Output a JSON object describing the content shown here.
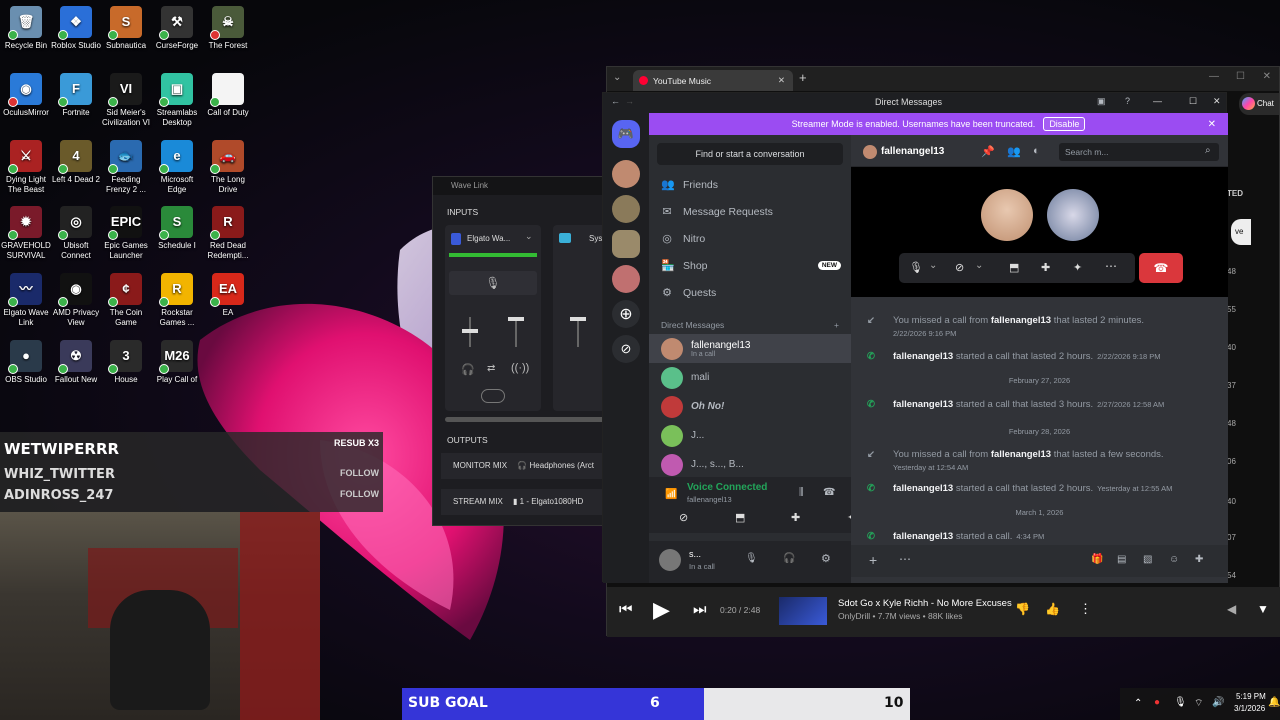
{
  "desktop_icons": [
    {
      "label": "Recycle Bin",
      "color": "#6a8fb0",
      "glyph": "🗑"
    },
    {
      "label": "Roblox Studio",
      "color": "#2a6fd8",
      "glyph": "❖"
    },
    {
      "label": "Subnautica",
      "color": "#c86a2a",
      "glyph": "S"
    },
    {
      "label": "CurseForge",
      "color": "#333",
      "glyph": "⚒"
    },
    {
      "label": "The Forest",
      "color": "#4a5a3a",
      "glyph": "☠"
    },
    {
      "label": "OculusMirror",
      "color": "#2a7ad8",
      "glyph": "◉"
    },
    {
      "label": "Fortnite",
      "color": "#3a9ad8",
      "glyph": "F"
    },
    {
      "label": "Sid Meier's Civilization VI",
      "color": "#1a1a1a",
      "glyph": "VI"
    },
    {
      "label": "Streamlabs Desktop",
      "color": "#31c3a2",
      "glyph": "▣"
    },
    {
      "label": "Call of Duty",
      "color": "#f4f4f4",
      "glyph": ""
    },
    {
      "label": "Dying Light The Beast",
      "color": "#a22",
      "glyph": "⚔"
    },
    {
      "label": "Left 4 Dead 2",
      "color": "#6a5a2a",
      "glyph": "4"
    },
    {
      "label": "Feeding Frenzy 2 ...",
      "color": "#2a6ab0",
      "glyph": "🐟"
    },
    {
      "label": "Microsoft Edge",
      "color": "#1a8ad8",
      "glyph": "e"
    },
    {
      "label": "The Long Drive",
      "color": "#b04a2a",
      "glyph": "🚗"
    },
    {
      "label": "GRAVEHOLD SURVIVAL",
      "color": "#7a1a2a",
      "glyph": "✹"
    },
    {
      "label": "Ubisoft Connect",
      "color": "#222",
      "glyph": "◎"
    },
    {
      "label": "Epic Games Launcher",
      "color": "#111",
      "glyph": "EPIC"
    },
    {
      "label": "Schedule I",
      "color": "#2a8a3a",
      "glyph": "S"
    },
    {
      "label": "Red Dead Redempti...",
      "color": "#8a1a1a",
      "glyph": "R"
    },
    {
      "label": "Elgato Wave Link",
      "color": "#1a2a6a",
      "glyph": "〰"
    },
    {
      "label": "AMD Privacy View",
      "color": "#111",
      "glyph": "◉"
    },
    {
      "label": "The Coin Game",
      "color": "#8a1a1a",
      "glyph": "¢"
    },
    {
      "label": "Rockstar Games ...",
      "color": "#f2b400",
      "glyph": "R"
    },
    {
      "label": "EA",
      "color": "#d8281a",
      "glyph": "EA"
    },
    {
      "label": "OBS Studio",
      "color": "#2a3a4a",
      "glyph": "●"
    },
    {
      "label": "Fallout New",
      "color": "#3a3a5a",
      "glyph": "☢"
    },
    {
      "label": "House",
      "color": "#2a2a2a",
      "glyph": "3"
    },
    {
      "label": "Play Call of",
      "color": "#2a2a2a",
      "glyph": "M26"
    }
  ],
  "overlay": {
    "alert1_name": "WETWIPERRR",
    "alert1_tag": "RESUB X3",
    "alert2_name": "WHIZ_TWITTER",
    "alert2_tag": "FOLLOW",
    "alert3_name": "ADINROSS_247",
    "alert3_tag": "FOLLOW",
    "subgoal_label": "SUB GOAL",
    "subgoal_current": "6",
    "subgoal_target": "10",
    "subgoal_progress": 0.6
  },
  "wavelink": {
    "title": "Wave Link",
    "inputs_label": "INPUTS",
    "input1": "Elgato Wa...",
    "input2": "Sys",
    "outputs_label": "OUTPUTS",
    "monitor_mix": "MONITOR MIX",
    "monitor_device": "Headphones (Arct",
    "stream_mix": "STREAM MIX",
    "stream_device": "1 - Elgato1080HD"
  },
  "youtube": {
    "tab_title": "YouTube Music",
    "song": "Sdot Go x Kyle Richh - No More Excuses",
    "meta": "OnlyDrill • 7.7M views • 88K likes",
    "time": "0:20 / 2:48",
    "side_numbers": [
      "48",
      "55",
      "40",
      "37",
      "48",
      "06",
      "40",
      "07",
      "54"
    ],
    "side_tag": "TED",
    "side_btn": "ve",
    "chat_btn": "Chat"
  },
  "discord": {
    "window_title": "Direct Messages",
    "streamer_text": "Streamer Mode is enabled. Usernames have been truncated.",
    "disable_label": "Disable",
    "find_placeholder": "Find or start a conversation",
    "nav": [
      {
        "label": "Friends",
        "icon": "👥"
      },
      {
        "label": "Message Requests",
        "icon": "✉"
      },
      {
        "label": "Nitro",
        "icon": "◎"
      },
      {
        "label": "Shop",
        "icon": "🏪",
        "badge": "NEW"
      },
      {
        "label": "Quests",
        "icon": "⚙"
      }
    ],
    "dm_header": "Direct Messages",
    "dms": [
      {
        "name": "fallenangel13",
        "sub": "In a call",
        "color": "#c08a70"
      },
      {
        "name": "mali",
        "sub": "",
        "color": "#5ac08a"
      },
      {
        "name": "Oh No!",
        "sub": "",
        "color": "#c03a3a"
      },
      {
        "name": "J...",
        "sub": "",
        "color": "#7ac05a"
      },
      {
        "name": "J..., s..., B...",
        "sub": "",
        "color": "#c05ab0"
      }
    ],
    "voice_connected": "Voice Connected",
    "voice_channel": "fallenangel13",
    "user_name": "s...",
    "user_status": "In a call",
    "chat_user": "fallenangel13",
    "search_placeholder": "Search m...",
    "messages": [
      {
        "type": "missed",
        "pre": "You missed a call from ",
        "name": "fallenangel13",
        "post": " that lasted 2 minutes.",
        "ts": "2/22/2026 9:16 PM"
      },
      {
        "type": "call",
        "name": "fallenangel13",
        "post": " started a call that lasted 2 hours.",
        "ts": "2/22/2026 9:18 PM"
      },
      {
        "type": "date",
        "text": "February 27, 2026"
      },
      {
        "type": "call",
        "name": "fallenangel13",
        "post": " started a call that lasted 3 hours.",
        "ts": "2/27/2026 12:58 AM"
      },
      {
        "type": "date",
        "text": "February 28, 2026"
      },
      {
        "type": "missed",
        "pre": "You missed a call from ",
        "name": "fallenangel13",
        "post": " that lasted a few seconds.",
        "ts": "Yesterday at 12:54 AM"
      },
      {
        "type": "call",
        "name": "fallenangel13",
        "post": " started a call that lasted 2 hours.",
        "ts": "Yesterday at 12:55 AM"
      },
      {
        "type": "date",
        "text": "March 1, 2026"
      },
      {
        "type": "call",
        "name": "fallenangel13",
        "post": " started a call.",
        "ts": "4:34 PM"
      }
    ]
  },
  "taskbar": {
    "time": "5:19 PM",
    "date": "3/1/2026"
  },
  "colors": {
    "discord_purple": "#9b4cf2",
    "discord_green": "#23a55a",
    "hangup_red": "#da373c",
    "subgoal_blue": "#3535d8"
  }
}
